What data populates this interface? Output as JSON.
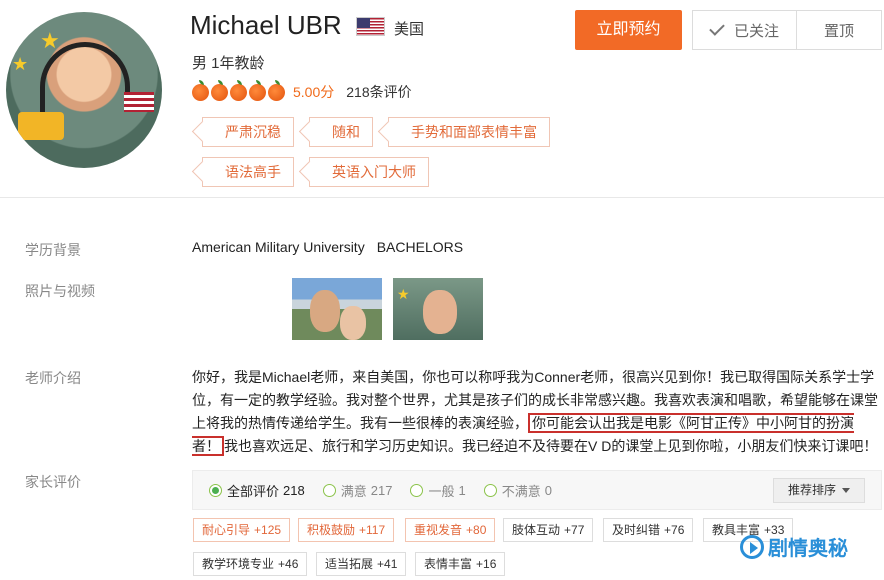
{
  "teacher": {
    "name": "Michael UBR",
    "country": "美国",
    "gender_years": "男  1年教龄",
    "score": "5.00分",
    "review_count": "218条评价",
    "traits": [
      "严肃沉稳",
      "随和",
      "手势和面部表情丰富",
      "语法高手",
      "英语入门大师"
    ]
  },
  "actions": {
    "book_label": "立即预约",
    "follow_label": "已关注",
    "pin_label": "置顶"
  },
  "sections": {
    "education_label": "学历背景",
    "education_school": "American Military University",
    "education_degree": "BACHELORS",
    "photos_label": "照片与视频",
    "intro_label": "老师介绍",
    "intro_part1": "你好，我是Michael老师，来自美国，你也可以称呼我为Conner老师，很高兴见到你！我已取得国际关系学士学位，有一定的教学经验。我对整个世界，尤其是孩子们的成长非常感兴趣。我喜欢表演和唱歌，希望能够在课堂上将我的热情传递给学生。我有一些很棒的表演经验，",
    "intro_highlight": "你可能会认出我是电影《阿甘正传》中小阿甘的扮演者！",
    "intro_part2": "我也喜欢远足、旅行和学习历史知识。我已经迫不及待要在V      D的课堂上见到你啦，小朋友们快来订课吧！",
    "reviews_label": "家长评价"
  },
  "review_filters": [
    {
      "label": "全部评价",
      "count": "218",
      "active": true
    },
    {
      "label": "满意",
      "count": "217",
      "active": false
    },
    {
      "label": "一般",
      "count": "1",
      "active": false
    },
    {
      "label": "不满意",
      "count": "0",
      "active": false
    }
  ],
  "sort_label": "推荐排序",
  "review_tags": [
    {
      "label": "耐心引导",
      "count": "+125",
      "positive": true
    },
    {
      "label": "积极鼓励",
      "count": "+117",
      "positive": true
    },
    {
      "label": "重视发音",
      "count": "+80",
      "positive": true
    },
    {
      "label": "肢体互动",
      "count": "+77",
      "positive": false
    },
    {
      "label": "及时纠错",
      "count": "+76",
      "positive": false
    },
    {
      "label": "教具丰富",
      "count": "+33",
      "positive": false
    },
    {
      "label": "教学环境专业",
      "count": "+46",
      "positive": false
    },
    {
      "label": "适当拓展",
      "count": "+41",
      "positive": false
    },
    {
      "label": "表情丰富",
      "count": "+16",
      "positive": false
    }
  ],
  "watermark": "剧情奥秘",
  "colors": {
    "accent": "#f26a26",
    "tag_border": "#f0c6b5",
    "highlight_box": "#c9302c",
    "watermark": "#2a8fd8"
  }
}
